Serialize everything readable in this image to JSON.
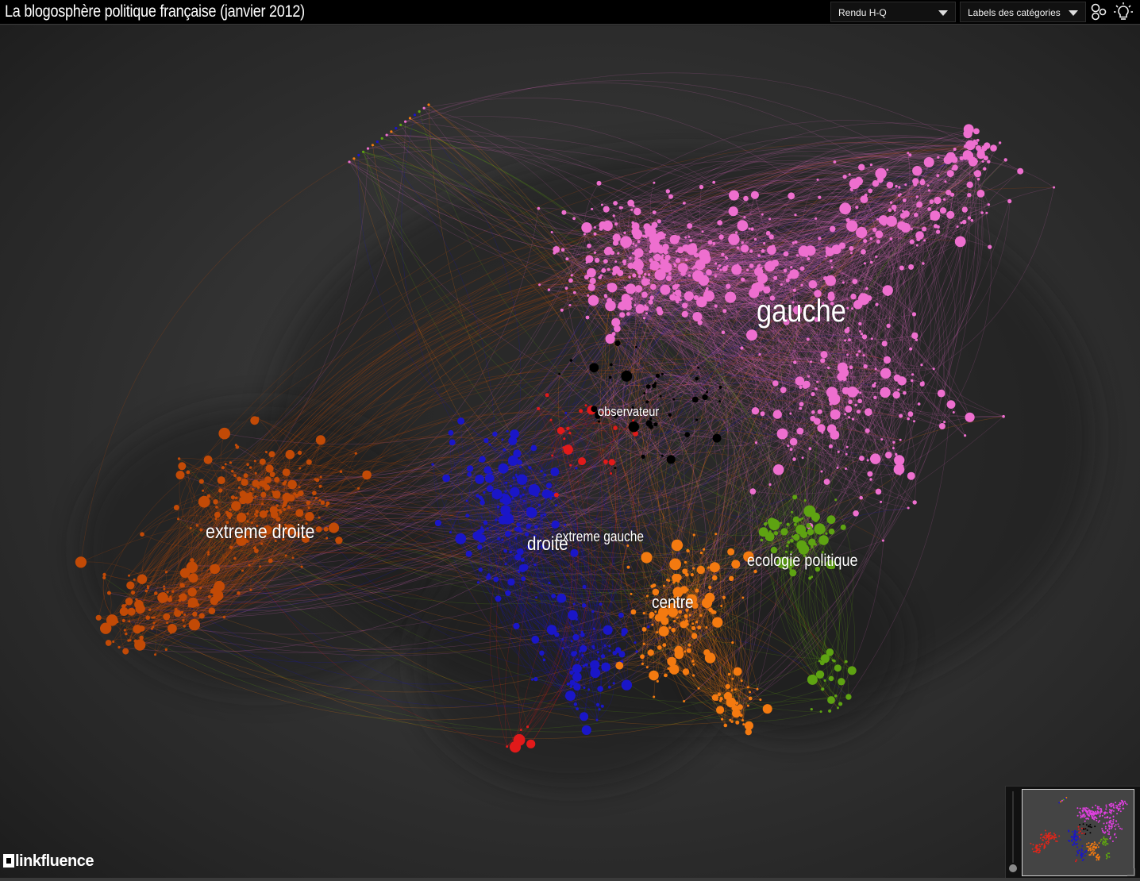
{
  "app": {
    "title": "La blogosphère politique française (janvier 2012)"
  },
  "toolbar": {
    "render_select": {
      "value": "Rendu H-Q"
    },
    "labels_select": {
      "value": "Labels des catégories"
    },
    "layout_icon": "nodes-cluster-icon",
    "highlight_icon": "lightbulb-icon"
  },
  "graph": {
    "background_color": "#333333",
    "categories": [
      {
        "key": "gauche",
        "label": "gauche",
        "color": "#ee6fcf"
      },
      {
        "key": "extreme_droite",
        "label": "extreme droite",
        "color": "#c24a06"
      },
      {
        "key": "droite",
        "label": "droite",
        "color": "#1a16c8"
      },
      {
        "key": "extreme_gauche",
        "label": "extreme gauche",
        "color": "#e11a1a"
      },
      {
        "key": "centre",
        "label": "centre",
        "color": "#f47a10"
      },
      {
        "key": "ecologie",
        "label": "ecologie politique",
        "color": "#5ea312"
      },
      {
        "key": "observateur",
        "label": "observateur",
        "color": "#000000"
      }
    ]
  },
  "footer": {
    "brand": "linkfluence"
  },
  "minimap": {
    "label": "overview-minimap"
  }
}
